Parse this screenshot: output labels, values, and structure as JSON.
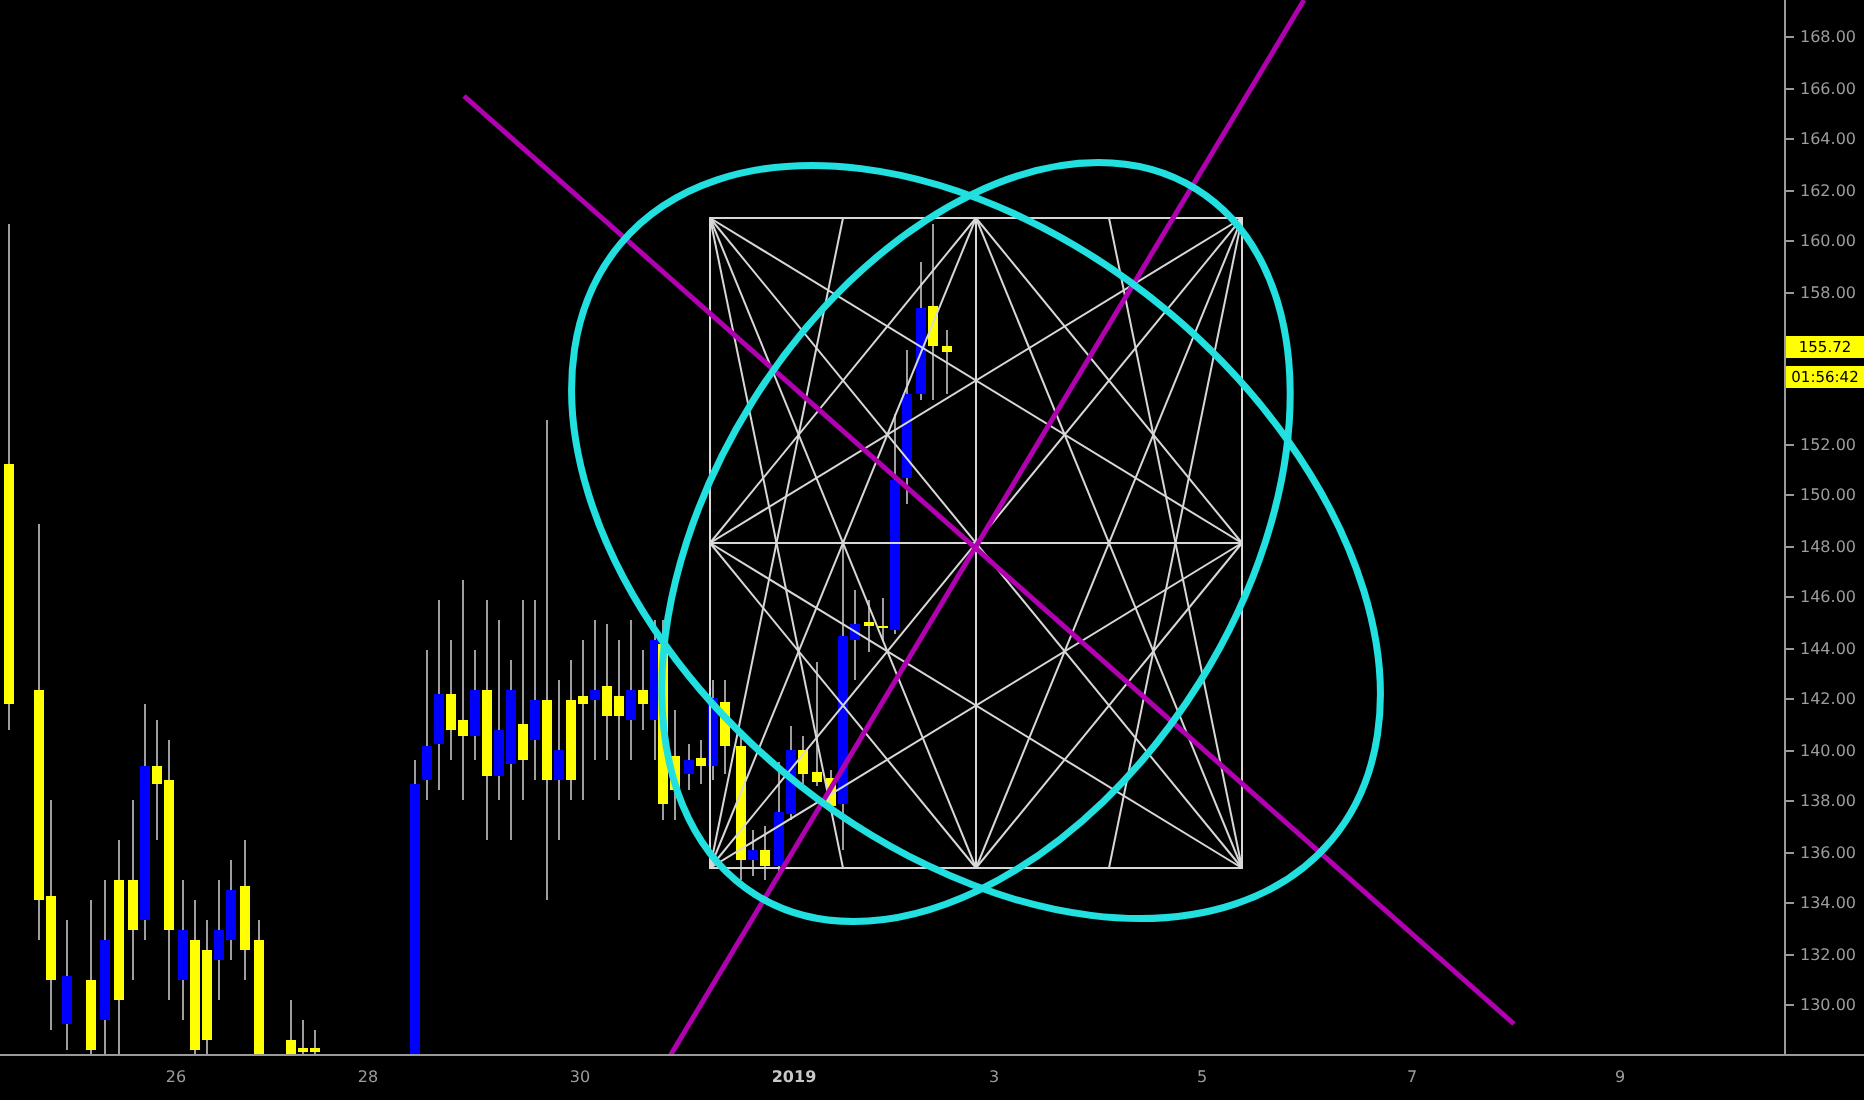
{
  "price_axis": {
    "ticks_upper": [
      "168.00",
      "166.00",
      "164.00",
      "162.00",
      "160.00",
      "158.00"
    ],
    "ticks_lower": [
      "152.00",
      "150.00",
      "148.00",
      "146.00",
      "144.00",
      "142.00",
      "140.00",
      "138.00",
      "136.00",
      "134.00",
      "132.00",
      "130.00"
    ],
    "last_price": "155.72",
    "countdown": "01:56:42"
  },
  "time_axis": {
    "labels": [
      {
        "text": "26",
        "kind": "day"
      },
      {
        "text": "28",
        "kind": "day"
      },
      {
        "text": "30",
        "kind": "day"
      },
      {
        "text": "2019",
        "kind": "year"
      },
      {
        "text": "3",
        "kind": "day"
      },
      {
        "text": "5",
        "kind": "day"
      },
      {
        "text": "7",
        "kind": "day"
      },
      {
        "text": "9",
        "kind": "day"
      }
    ]
  }
}
